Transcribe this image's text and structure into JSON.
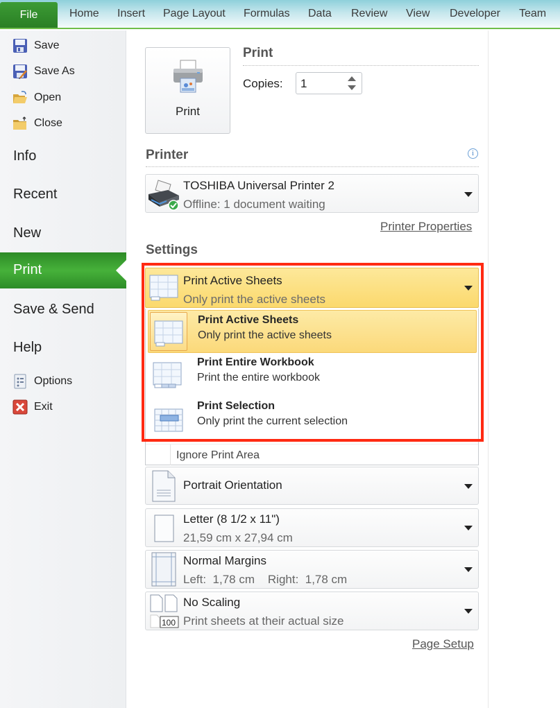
{
  "ribbon": {
    "file_tab": "File",
    "tabs": [
      "Home",
      "Insert",
      "Page Layout",
      "Formulas",
      "Data",
      "Review",
      "View",
      "Developer",
      "Team"
    ]
  },
  "sidebar": {
    "commands_top": [
      {
        "label": "Save",
        "icon": "save-icon"
      },
      {
        "label": "Save As",
        "icon": "save-as-icon"
      },
      {
        "label": "Open",
        "icon": "open-folder-icon"
      },
      {
        "label": "Close",
        "icon": "close-folder-icon"
      }
    ],
    "tabs": [
      "Info",
      "Recent",
      "New",
      "Print",
      "Save & Send",
      "Help"
    ],
    "active_tab": "Print",
    "commands_bottom": [
      {
        "label": "Options",
        "icon": "options-icon"
      },
      {
        "label": "Exit",
        "icon": "exit-icon"
      }
    ]
  },
  "print": {
    "button_label": "Print",
    "section_title": "Print",
    "copies_label": "Copies:",
    "copies_value": "1"
  },
  "printer": {
    "section_title": "Printer",
    "name": "TOSHIBA Universal Printer 2",
    "status": "Offline: 1 document waiting",
    "properties_link": "Printer Properties"
  },
  "settings": {
    "section_title": "Settings",
    "print_what": {
      "title": "Print Active Sheets",
      "subtitle": "Only print the active sheets",
      "options": [
        {
          "title": "Print Active Sheets",
          "subtitle": "Only print the active sheets",
          "selected": true
        },
        {
          "title": "Print Entire Workbook",
          "subtitle": "Print the entire workbook",
          "selected": false
        },
        {
          "title": "Print Selection",
          "subtitle": "Only print the current selection",
          "selected": false
        }
      ],
      "ignore_print_area": "Ignore Print Area"
    },
    "orientation": {
      "title": "Portrait Orientation"
    },
    "paper": {
      "title": "Letter (8 1/2 x 11\")",
      "subtitle": "21,59 cm x 27,94 cm"
    },
    "margins": {
      "title": "Normal Margins",
      "subtitle": "Left:  1,78 cm    Right:  1,78 cm"
    },
    "scaling": {
      "title": "No Scaling",
      "subtitle": "Print sheets at their actual size",
      "badge": "100"
    },
    "page_setup_link": "Page Setup"
  },
  "colors": {
    "accent_green": "#3a9a31",
    "highlight_red": "#ff2a12",
    "selected_yellow": "#fbd96d"
  }
}
